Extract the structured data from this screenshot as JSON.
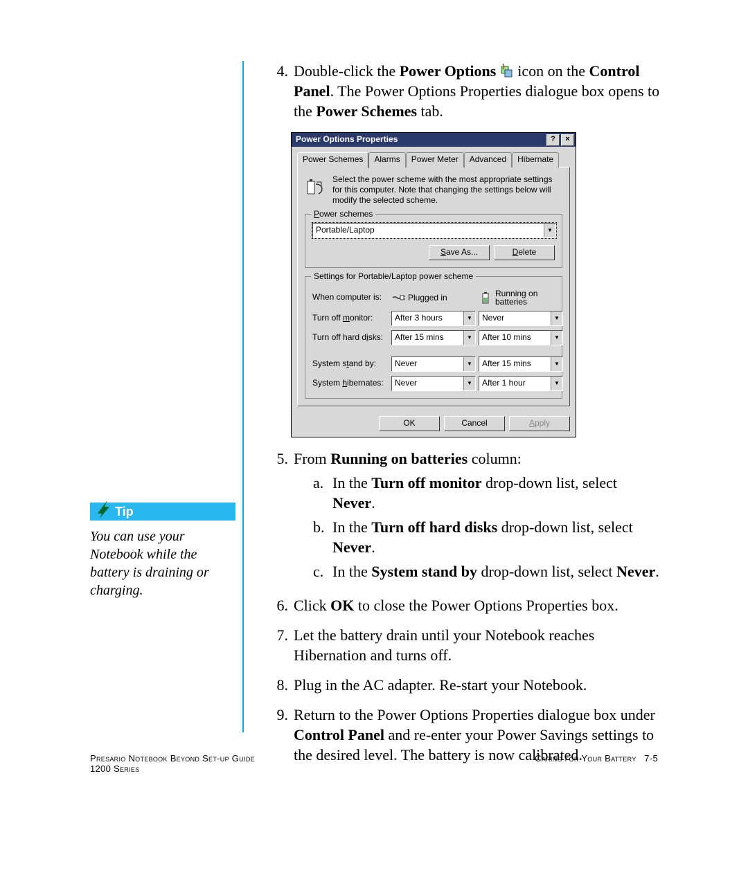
{
  "sidebar": {
    "tip_label": "Tip",
    "tip_body": "You can use your Notebook while the battery is draining or charging."
  },
  "steps": {
    "s4": {
      "num": "4.",
      "pre": "Double-click the ",
      "bold1": "Power Options",
      "mid1": " icon on the ",
      "bold2": "Control Panel",
      "mid2": ". The Power Options Properties dialogue box opens to the ",
      "bold3": "Power Schemes",
      "post": " tab."
    },
    "s5": {
      "num": "5.",
      "pre": "From ",
      "bold": "Running on batteries",
      "post": " column:"
    },
    "s5a": {
      "letter": "a.",
      "pre": "In the ",
      "b1": "Turn off monitor",
      "mid": " drop-down list, select ",
      "b2": "Never",
      "post": "."
    },
    "s5b": {
      "letter": "b.",
      "pre": "In the ",
      "b1": "Turn off hard disks",
      "mid": " drop-down list, select ",
      "b2": "Never",
      "post": "."
    },
    "s5c": {
      "letter": "c.",
      "pre": "In the ",
      "b1": "System stand by",
      "mid": " drop-down list, select ",
      "b2": "Never",
      "post": "."
    },
    "s6": {
      "num": "6.",
      "pre": "Click ",
      "b1": "OK",
      "post": " to close the Power Options Properties box."
    },
    "s7": {
      "num": "7.",
      "text": "Let the battery drain until your Notebook reaches Hibernation and turns off."
    },
    "s8": {
      "num": "8.",
      "text": "Plug in the AC adapter. Re-start your Notebook."
    },
    "s9": {
      "num": "9.",
      "pre": "Return to the Power Options Properties dialogue box under ",
      "b1": "Control Panel",
      "post": " and re-enter your Power Savings settings to the desired level. The battery is now calibrated."
    }
  },
  "dialog": {
    "title": "Power Options Properties",
    "help_btn": "?",
    "close_btn": "×",
    "tabs": [
      "Power Schemes",
      "Alarms",
      "Power Meter",
      "Advanced",
      "Hibernate"
    ],
    "desc": "Select the power scheme with the most appropriate settings for this computer. Note that changing the settings below will modify the selected scheme.",
    "group_schemes": "Power schemes",
    "scheme_selected": "Portable/Laptop",
    "saveas": "Save As...",
    "delete": "Delete",
    "group_settings": "Settings for Portable/Laptop power scheme",
    "when_label": "When computer is:",
    "plugged": "Plugged in",
    "running": "Running on batteries",
    "rows": {
      "monitor": {
        "label": "Turn off monitor:",
        "plugged": "After 3 hours",
        "battery": "Never"
      },
      "disks": {
        "label": "Turn off hard disks:",
        "plugged": "After 15 mins",
        "battery": "After 10 mins"
      },
      "standby": {
        "label": "System stand by:",
        "plugged": "Never",
        "battery": "After 15 mins"
      },
      "hibernate": {
        "label": "System hibernates:",
        "plugged": "Never",
        "battery": "After 1 hour"
      }
    },
    "ok": "OK",
    "cancel": "Cancel",
    "apply": "Apply"
  },
  "footer": {
    "left_line1": "Presario Notebook Beyond Set-up Guide",
    "left_line2": "1200 Series",
    "right": "Caring for Your Battery",
    "page": "7-5"
  }
}
